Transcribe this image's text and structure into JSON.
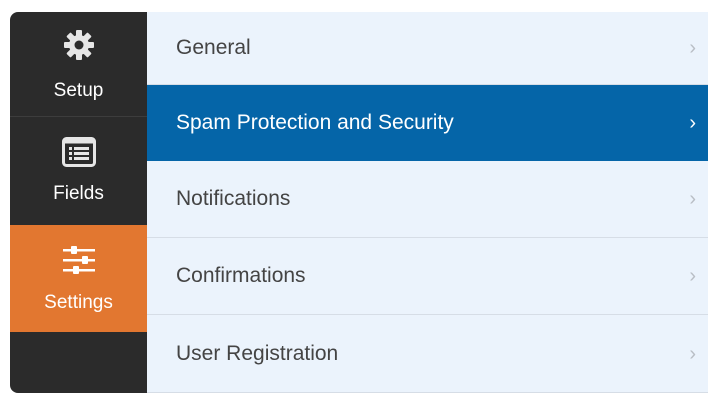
{
  "sidebar": {
    "items": [
      {
        "label": "Setup",
        "icon": "gear-icon"
      },
      {
        "label": "Fields",
        "icon": "list-icon"
      },
      {
        "label": "Settings",
        "icon": "sliders-icon",
        "active": true
      }
    ],
    "active_color": "#e27730",
    "background": "#2b2b2b"
  },
  "menu": {
    "items": [
      {
        "label": "General"
      },
      {
        "label": "Spam Protection and Security",
        "active": true
      },
      {
        "label": "Notifications"
      },
      {
        "label": "Confirmations"
      },
      {
        "label": "User Registration"
      }
    ],
    "chevron": "›",
    "active_color": "#0565a8",
    "background": "#ebf3fc"
  }
}
